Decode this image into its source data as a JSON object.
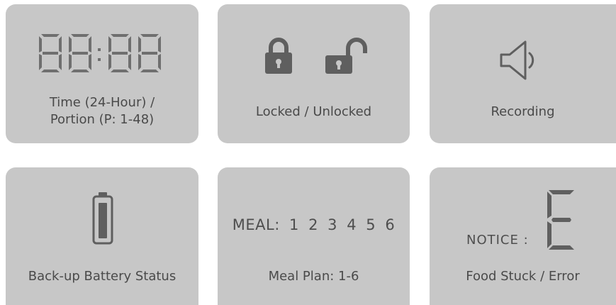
{
  "cards": {
    "time": {
      "caption_line1": "Time (24-Hour) /",
      "caption_line2": "Portion (P: 1-48)"
    },
    "lock": {
      "caption": "Locked / Unlocked"
    },
    "recording": {
      "caption": "Recording"
    },
    "battery": {
      "caption": "Back-up Battery Status"
    },
    "meal": {
      "label": "MEAL:",
      "numbers": [
        "1",
        "2",
        "3",
        "4",
        "5",
        "6"
      ],
      "caption": "Meal Plan: 1-6"
    },
    "error": {
      "notice_label": "NOTICE :",
      "caption": "Food Stuck / Error"
    }
  },
  "icons": {
    "time": "seven-segment-clock-icon",
    "locked": "locked-padlock-icon",
    "unlocked": "unlocked-padlock-icon",
    "recording": "speaker-icon",
    "battery": "battery-icon",
    "error": "seven-segment-e-icon"
  },
  "colors": {
    "card": "#c7c7c7",
    "icon": "#5f5f5f",
    "segment": "#6f6f6f",
    "text": "#4a4a4a"
  }
}
